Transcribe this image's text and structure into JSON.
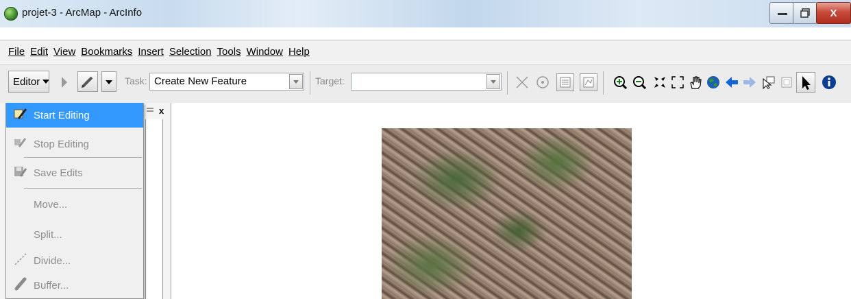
{
  "window": {
    "title": "projet-3 - ArcMap - ArcInfo",
    "close_label": "X"
  },
  "menubar": {
    "items": [
      "File",
      "Edit",
      "View",
      "Bookmarks",
      "Insert",
      "Selection",
      "Tools",
      "Window",
      "Help"
    ]
  },
  "editor_toolbar": {
    "editor_label": "Editor",
    "task_label": "Task:",
    "task_value": "Create New Feature",
    "target_label": "Target:",
    "target_value": ""
  },
  "editor_menu": {
    "items": [
      {
        "label": "Start Editing",
        "icon": "start-editing-icon",
        "enabled": true,
        "highlighted": true
      },
      {
        "label": "Stop Editing",
        "icon": "stop-editing-icon",
        "enabled": false
      },
      {
        "label": "Save Edits",
        "icon": "save-edits-icon",
        "enabled": false
      },
      {
        "label": "Move...",
        "icon": "",
        "enabled": false
      },
      {
        "label": "Split...",
        "icon": "",
        "enabled": false
      },
      {
        "label": "Divide...",
        "icon": "divide-icon",
        "enabled": false
      },
      {
        "label": "Buffer...",
        "icon": "buffer-icon",
        "enabled": false
      }
    ]
  },
  "toc": {
    "close_label": "x"
  },
  "colors": {
    "highlight": "#3399ff",
    "disabled_text": "#8d8d8d",
    "close_red": "#c8493a"
  }
}
